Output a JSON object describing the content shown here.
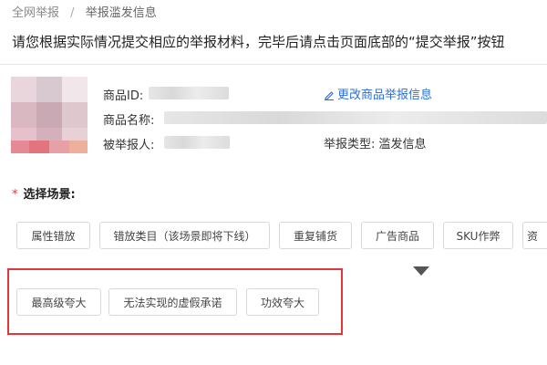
{
  "breadcrumb": {
    "root": "全网举报",
    "separator": "/",
    "current": "举报滥发信息"
  },
  "instruction": "请您根据实际情况提交相应的举报材料，完毕后请点击页面底部的“提交举报”按钮",
  "product": {
    "id_label": "商品ID:",
    "name_label": "商品名称:",
    "reported_label": "被举报人:",
    "edit_link": "更改商品举报信息",
    "report_type_label": "举报类型:",
    "report_type_value": "滥发信息"
  },
  "scene": {
    "required_mark": "*",
    "title": "选择场景:",
    "options_row1": [
      "属性错放",
      "错放类目（该场景即将下线）",
      "重复铺货",
      "广告商品",
      "SKU作弊",
      "资"
    ],
    "options_row2": [
      "最高级夸大",
      "无法实现的虚假承诺",
      "功效夸大"
    ]
  },
  "colors": {
    "link": "#2d6fd8",
    "required": "#e4393c",
    "highlight_border": "#e2373a"
  }
}
